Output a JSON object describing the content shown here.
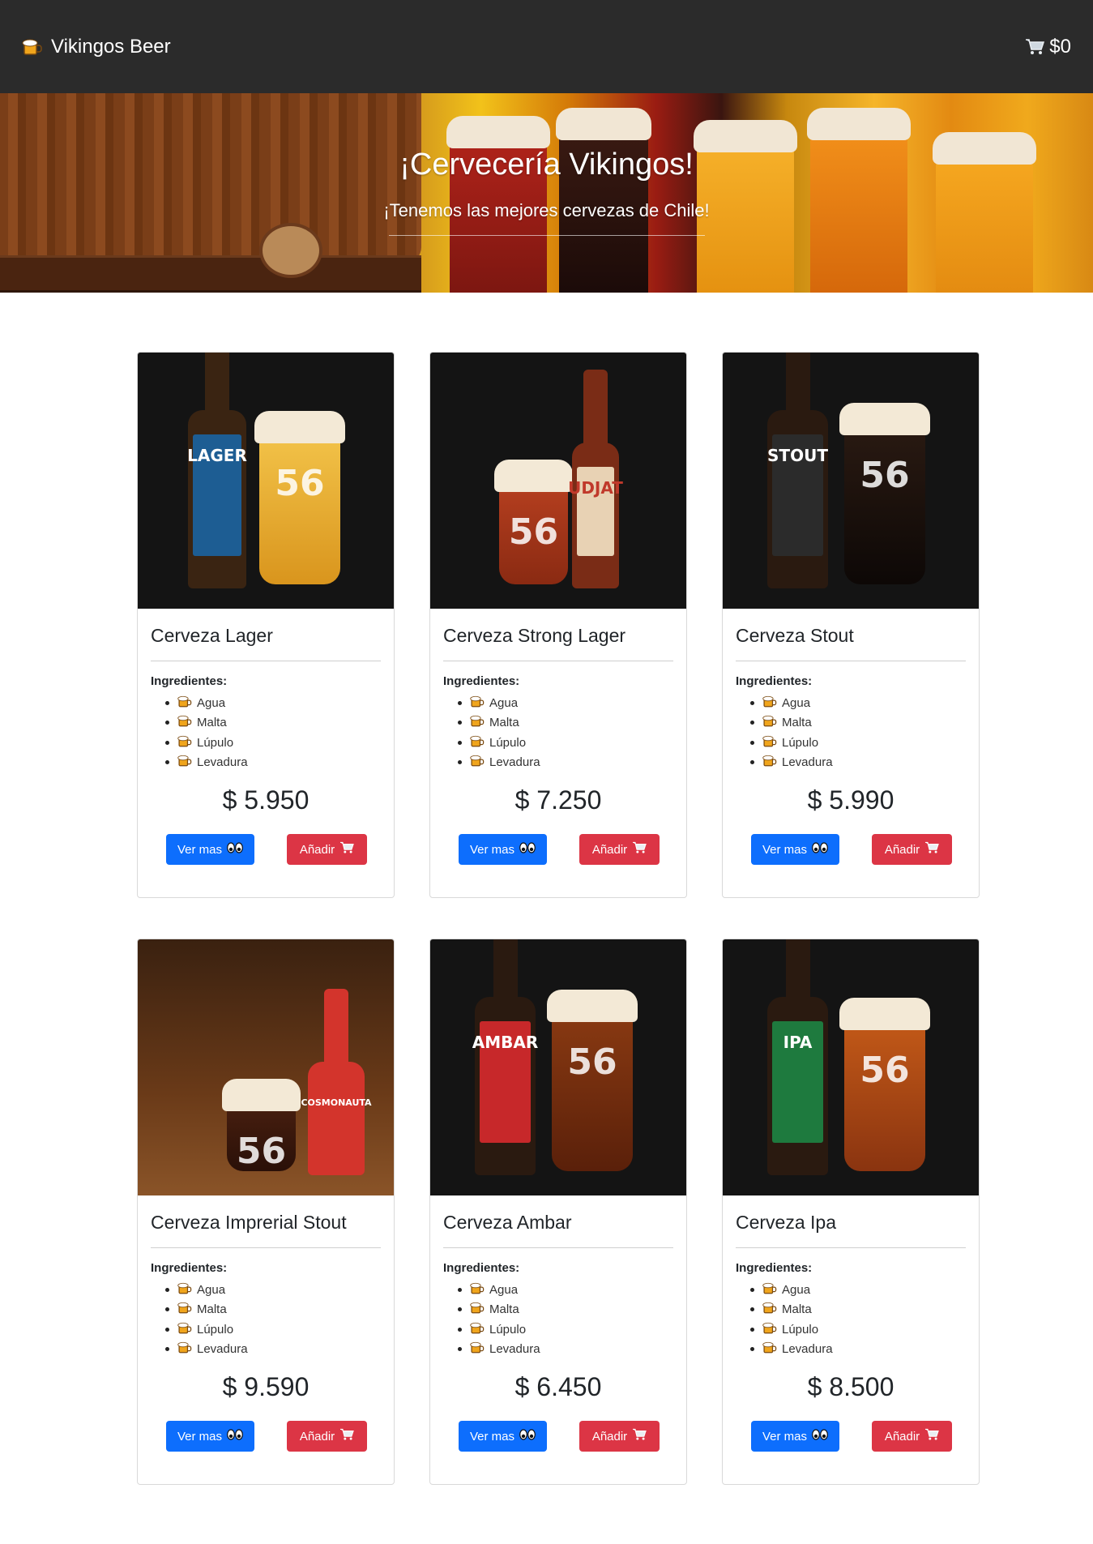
{
  "navbar": {
    "brand": "Vikingos Beer",
    "cart_total": "$0"
  },
  "hero": {
    "title": "¡Cervecería Vikingos!",
    "subtitle": "¡Tenemos las mejores cervezas de Chile!"
  },
  "ingredients_label": "Ingredientes:",
  "buttons": {
    "more": "Ver mas",
    "add": "Añadir"
  },
  "products": [
    {
      "name": "Cerveza Lager",
      "price": "$ 5.950",
      "ingredients": [
        "Agua",
        "Malta",
        "Lúpulo",
        "Levadura"
      ]
    },
    {
      "name": "Cerveza Strong Lager",
      "price": "$ 7.250",
      "ingredients": [
        "Agua",
        "Malta",
        "Lúpulo",
        "Levadura"
      ]
    },
    {
      "name": "Cerveza Stout",
      "price": "$ 5.990",
      "ingredients": [
        "Agua",
        "Malta",
        "Lúpulo",
        "Levadura"
      ]
    },
    {
      "name": "Cerveza Imprerial Stout",
      "price": "$ 9.590",
      "ingredients": [
        "Agua",
        "Malta",
        "Lúpulo",
        "Levadura"
      ]
    },
    {
      "name": "Cerveza Ambar",
      "price": "$ 6.450",
      "ingredients": [
        "Agua",
        "Malta",
        "Lúpulo",
        "Levadura"
      ]
    },
    {
      "name": "Cerveza Ipa",
      "price": "$ 8.500",
      "ingredients": [
        "Agua",
        "Malta",
        "Lúpulo",
        "Levadura"
      ]
    }
  ],
  "image_labels": [
    "LAGER",
    "UDJAT",
    "STOUT",
    "COSMONAUTA",
    "AMBAR",
    "IPA"
  ],
  "colors": {
    "navbar": "#2b2b2b",
    "primary": "#0d6efd",
    "danger": "#dc3545"
  },
  "icons": {
    "brand": "beer-mug-icon",
    "cart": "shopping-cart-icon",
    "ingredient": "beer-mug-icon",
    "more": "eyes-icon",
    "add": "shopping-cart-icon"
  }
}
